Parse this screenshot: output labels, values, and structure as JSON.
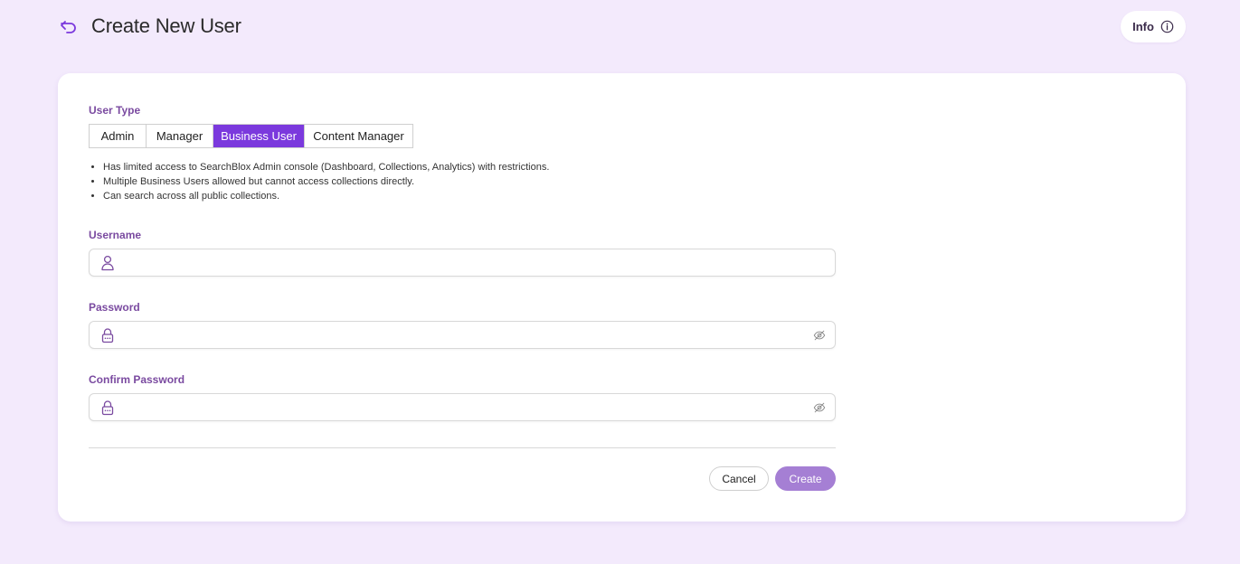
{
  "header": {
    "title": "Create New User",
    "info_label": "Info"
  },
  "form": {
    "user_type_label": "User Type",
    "user_types": [
      "Admin",
      "Manager",
      "Business User",
      "Content Manager"
    ],
    "selected_user_type": "Business User",
    "description": [
      "Has limited access to SearchBlox Admin console (Dashboard, Collections, Analytics) with restrictions.",
      "Multiple Business Users allowed but cannot access collections directly.",
      "Can search across all public collections."
    ],
    "username": {
      "label": "Username",
      "value": "",
      "placeholder": ""
    },
    "password": {
      "label": "Password",
      "value": "",
      "placeholder": ""
    },
    "confirm_password": {
      "label": "Confirm Password",
      "value": "",
      "placeholder": ""
    },
    "cancel_label": "Cancel",
    "create_label": "Create"
  },
  "colors": {
    "accent": "#7b39dd",
    "label": "#7a4aa0",
    "create_button": "#a57fd4",
    "background": "#f3eafc"
  },
  "icons": {
    "back": "undo-arrow-icon",
    "info": "info-circle-icon",
    "username": "user-icon",
    "password": "lock-icon",
    "visibility": "eye-off-icon"
  }
}
